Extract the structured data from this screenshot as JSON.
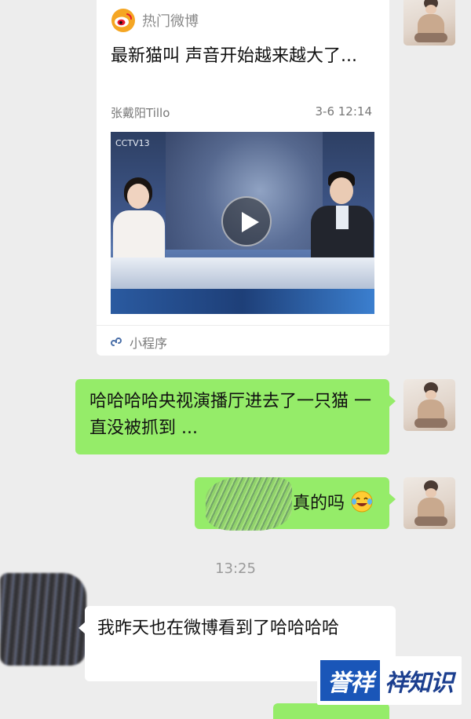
{
  "shared_card": {
    "source_name": "热门微博",
    "title": "最新猫叫 声音开始越来越大了...",
    "author": "张戴阳Tillo",
    "timestamp": "3-6 12:14",
    "video_logo": "CCTV13",
    "footer_label": "小程序"
  },
  "messages": [
    {
      "side": "right",
      "text": "哈哈哈哈央视演播厅进去了一只猫 一直没被抓到 ..."
    },
    {
      "side": "right",
      "text": "真的吗"
    },
    {
      "side": "left",
      "text": "我昨天也在微博看到了哈哈哈哈"
    }
  ],
  "time_divider": "13:25",
  "watermark": {
    "badge": "誉祥",
    "text": "祥知识"
  },
  "colors": {
    "background": "#ededed",
    "bubble_green": "#95ec69",
    "bubble_white": "#ffffff",
    "weibo_red": "#e6162d",
    "weibo_orange": "#f5a623",
    "watermark_blue": "#1a56b8"
  },
  "icons": {
    "source": "weibo-logo-icon",
    "play": "play-icon",
    "mini_program": "mini-program-icon",
    "emoji": "laughing-tears-emoji"
  }
}
